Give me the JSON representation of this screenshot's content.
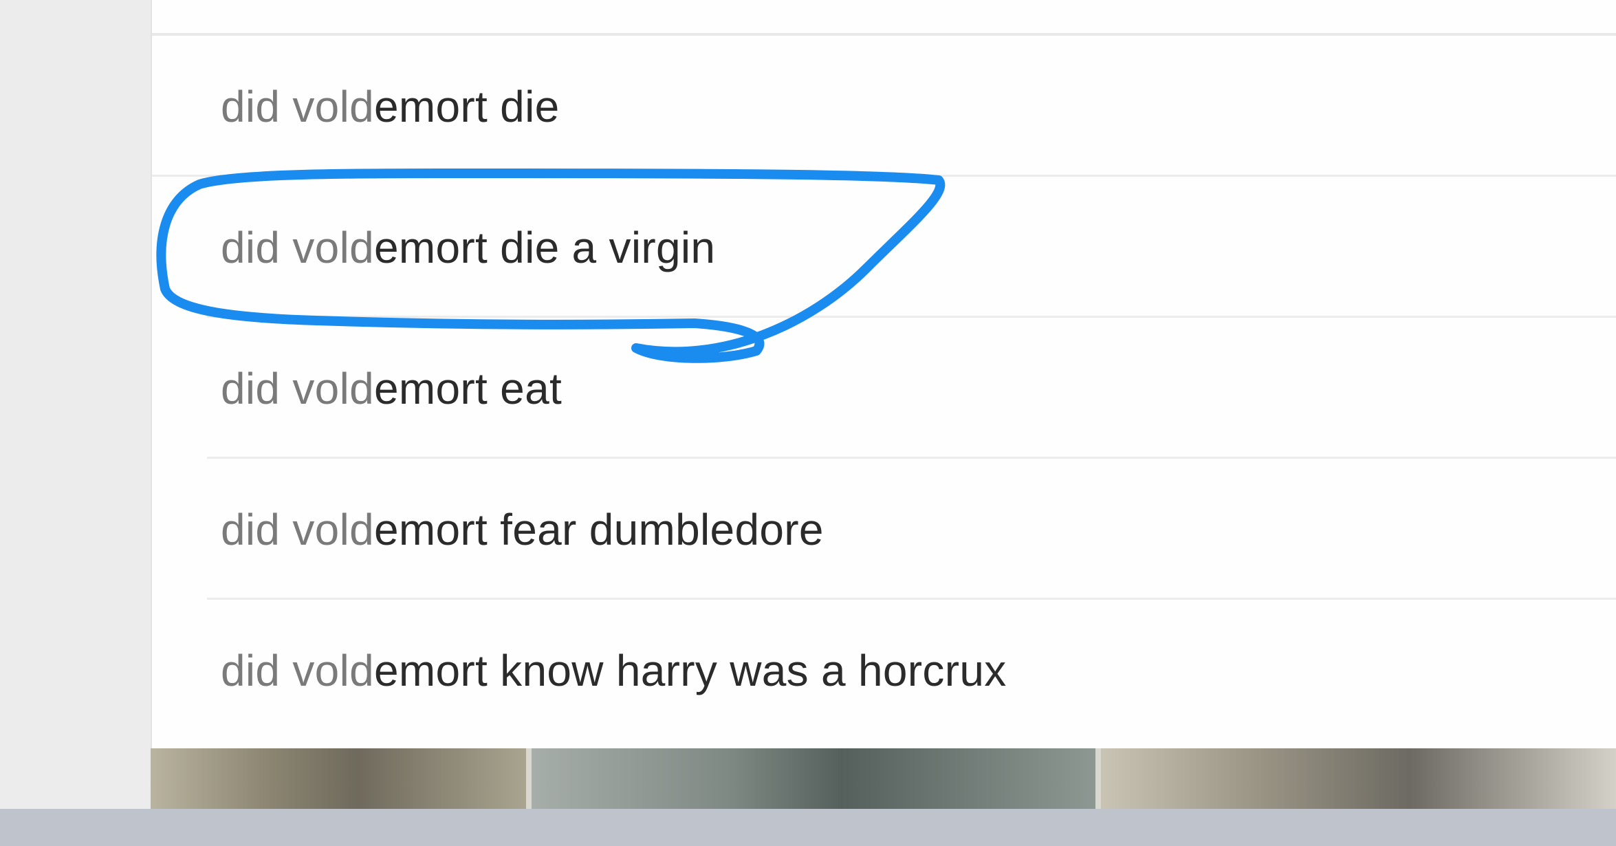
{
  "suggestions": [
    {
      "typed": "did vold",
      "completion": "emort die"
    },
    {
      "typed": "did vold",
      "completion": "emort die a virgin"
    },
    {
      "typed": "did vold",
      "completion": "emort eat"
    },
    {
      "typed": "did vold",
      "completion": "emort fear dumbledore"
    },
    {
      "typed": "did vold",
      "completion": "emort know harry was a horcrux"
    }
  ],
  "highlighted_index": 1,
  "colors": {
    "annotation": "#1a8cf0",
    "typed_text": "#7a7a7a",
    "completion_text": "#2b2b2b"
  }
}
